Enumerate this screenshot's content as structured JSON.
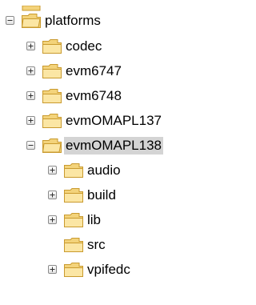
{
  "tree": {
    "root": {
      "label": "platforms",
      "expanded": true
    },
    "children": [
      {
        "label": "codec",
        "expanded": false,
        "has_children": true
      },
      {
        "label": "evm6747",
        "expanded": false,
        "has_children": true
      },
      {
        "label": "evm6748",
        "expanded": false,
        "has_children": true
      },
      {
        "label": "evmOMAPL137",
        "expanded": false,
        "has_children": true
      },
      {
        "label": "evmOMAPL138",
        "expanded": true,
        "has_children": true,
        "selected": true
      }
    ],
    "sub_children": [
      {
        "label": "audio",
        "expanded": false,
        "has_children": true
      },
      {
        "label": "build",
        "expanded": false,
        "has_children": true
      },
      {
        "label": "lib",
        "expanded": false,
        "has_children": true
      },
      {
        "label": "src",
        "expanded": false,
        "has_children": false
      },
      {
        "label": "vpifedc",
        "expanded": false,
        "has_children": true
      }
    ]
  },
  "colors": {
    "folder_fill": "#f3d37b",
    "folder_outline": "#c99a2e",
    "selection_bg": "#d4d4d4"
  }
}
